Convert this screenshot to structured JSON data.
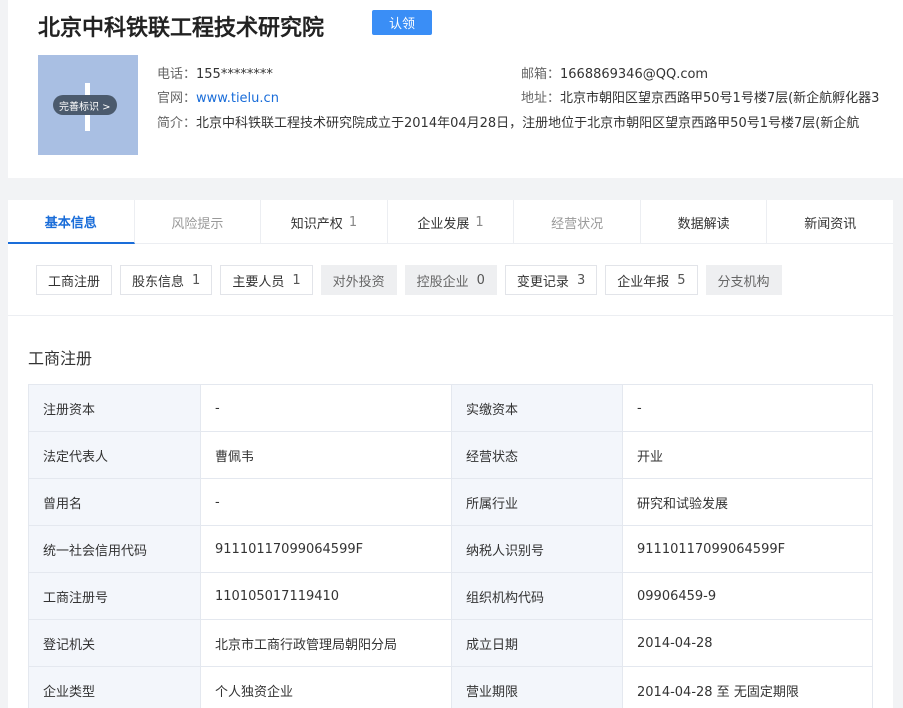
{
  "company": {
    "name": "北京中科铁联工程技术研究院",
    "claim_label": "认领",
    "logo_hint": "完善标识 >",
    "phone_label": "电话：",
    "phone_value": "155********",
    "email_label": "邮箱：",
    "email_value": "1668869346@QQ.com",
    "website_label": "官网：",
    "website_value": "www.tielu.cn",
    "address_label": "地址：",
    "address_value": "北京市朝阳区望京西路甲50号1号楼7层(新企航孵化器3",
    "intro_label": "简介：",
    "intro_value": "北京中科铁联工程技术研究院成立于2014年04月28日，注册地位于北京市朝阳区望京西路甲50号1号楼7层(新企航"
  },
  "tabs": [
    {
      "label": "基本信息",
      "count": ""
    },
    {
      "label": "风险提示",
      "count": ""
    },
    {
      "label": "知识产权",
      "count": "1"
    },
    {
      "label": "企业发展",
      "count": "1"
    },
    {
      "label": "经营状况",
      "count": ""
    },
    {
      "label": "数据解读",
      "count": ""
    },
    {
      "label": "新闻资讯",
      "count": ""
    }
  ],
  "subtabs": [
    {
      "label": "工商注册",
      "count": ""
    },
    {
      "label": "股东信息",
      "count": "1"
    },
    {
      "label": "主要人员",
      "count": "1"
    },
    {
      "label": "对外投资",
      "count": ""
    },
    {
      "label": "控股企业",
      "count": "0"
    },
    {
      "label": "变更记录",
      "count": "3"
    },
    {
      "label": "企业年报",
      "count": "5"
    },
    {
      "label": "分支机构",
      "count": ""
    }
  ],
  "section_title": "工商注册",
  "registration": [
    {
      "l1": "注册资本",
      "v1": "-",
      "l2": "实缴资本",
      "v2": "-"
    },
    {
      "l1": "法定代表人",
      "v1": "曹佩韦",
      "l2": "经营状态",
      "v2": "开业"
    },
    {
      "l1": "曾用名",
      "v1": "-",
      "l2": "所属行业",
      "v2": "研究和试验发展"
    },
    {
      "l1": "统一社会信用代码",
      "v1": "91110117099064599F",
      "l2": "纳税人识别号",
      "v2": "91110117099064599F"
    },
    {
      "l1": "工商注册号",
      "v1": "110105017119410",
      "l2": "组织机构代码",
      "v2": "09906459-9"
    },
    {
      "l1": "登记机关",
      "v1": "北京市工商行政管理局朝阳分局",
      "l2": "成立日期",
      "v2": "2014-04-28"
    },
    {
      "l1": "企业类型",
      "v1": "个人独资企业",
      "l2": "营业期限",
      "v2": "2014-04-28 至 无固定期限"
    }
  ],
  "colors": {
    "accent": "#1a6dd9",
    "claim_button": "#3a8ef6",
    "logo_bg": "#a9bfe3",
    "label_cell_bg": "#f3f6fb"
  }
}
